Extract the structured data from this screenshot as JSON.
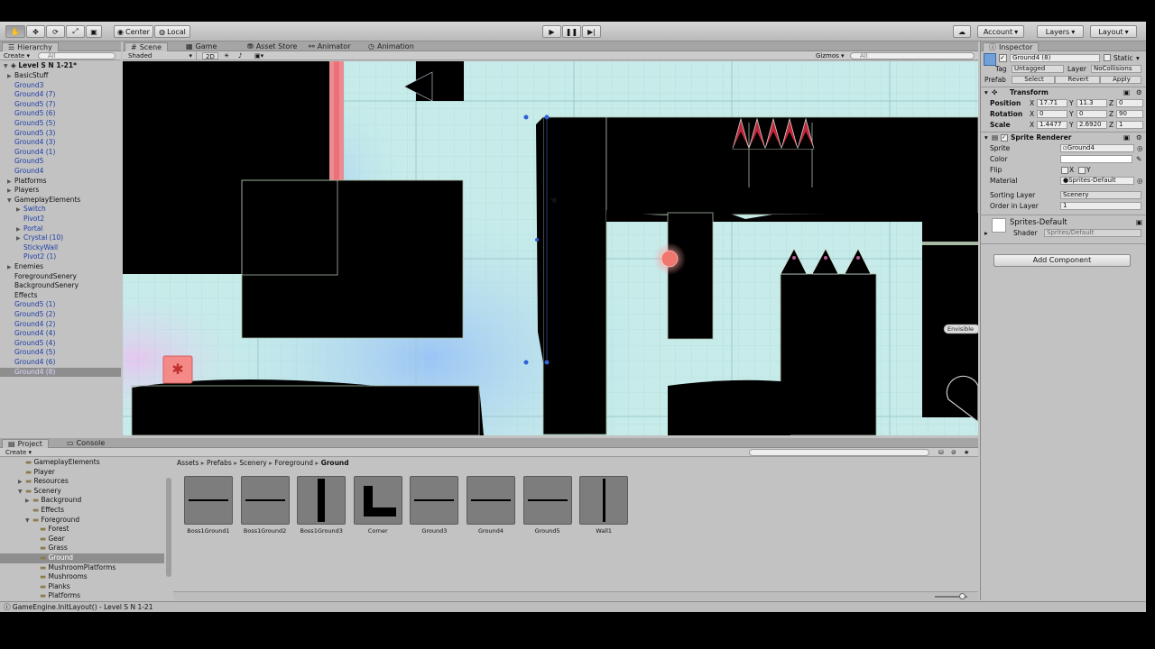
{
  "toolbar": {
    "pivot_label": "Center",
    "space_label": "Local",
    "account_label": "Account",
    "layers_label": "Layers",
    "layout_label": "Layout"
  },
  "hierarchy": {
    "tab": "Hierarchy",
    "create": "Create",
    "search_placeholder": "All",
    "scene_name": "Level S N 1-21*",
    "items": [
      {
        "label": "BasicStuff",
        "indent": 1,
        "arrow": "right",
        "prefab": false,
        "selected": false
      },
      {
        "label": "Ground3",
        "indent": 1,
        "arrow": "",
        "prefab": true,
        "selected": false
      },
      {
        "label": "Ground4 (7)",
        "indent": 1,
        "arrow": "",
        "prefab": true,
        "selected": false
      },
      {
        "label": "Ground5 (7)",
        "indent": 1,
        "arrow": "",
        "prefab": true,
        "selected": false
      },
      {
        "label": "Ground5 (6)",
        "indent": 1,
        "arrow": "",
        "prefab": true,
        "selected": false
      },
      {
        "label": "Ground5 (5)",
        "indent": 1,
        "arrow": "",
        "prefab": true,
        "selected": false
      },
      {
        "label": "Ground5 (3)",
        "indent": 1,
        "arrow": "",
        "prefab": true,
        "selected": false
      },
      {
        "label": "Ground4 (3)",
        "indent": 1,
        "arrow": "",
        "prefab": true,
        "selected": false
      },
      {
        "label": "Ground4 (1)",
        "indent": 1,
        "arrow": "",
        "prefab": true,
        "selected": false
      },
      {
        "label": "Ground5",
        "indent": 1,
        "arrow": "",
        "prefab": true,
        "selected": false
      },
      {
        "label": "Ground4",
        "indent": 1,
        "arrow": "",
        "prefab": true,
        "selected": false
      },
      {
        "label": "Platforms",
        "indent": 1,
        "arrow": "right",
        "prefab": false,
        "selected": false
      },
      {
        "label": "Players",
        "indent": 1,
        "arrow": "right",
        "prefab": false,
        "selected": false
      },
      {
        "label": "GameplayElements",
        "indent": 1,
        "arrow": "down",
        "prefab": false,
        "selected": false
      },
      {
        "label": "Switch",
        "indent": 2,
        "arrow": "right",
        "prefab": true,
        "selected": false
      },
      {
        "label": "Pivot2",
        "indent": 2,
        "arrow": "",
        "prefab": true,
        "selected": false
      },
      {
        "label": "Portal",
        "indent": 2,
        "arrow": "right",
        "prefab": true,
        "selected": false
      },
      {
        "label": "Crystal (10)",
        "indent": 2,
        "arrow": "right",
        "prefab": true,
        "selected": false
      },
      {
        "label": "StickyWall",
        "indent": 2,
        "arrow": "",
        "prefab": true,
        "selected": false
      },
      {
        "label": "Pivot2 (1)",
        "indent": 2,
        "arrow": "",
        "prefab": true,
        "selected": false
      },
      {
        "label": "Enemies",
        "indent": 1,
        "arrow": "right",
        "prefab": false,
        "selected": false
      },
      {
        "label": "ForegroundSenery",
        "indent": 1,
        "arrow": "",
        "prefab": false,
        "selected": false
      },
      {
        "label": "BackgroundSenery",
        "indent": 1,
        "arrow": "",
        "prefab": false,
        "selected": false
      },
      {
        "label": "Effects",
        "indent": 1,
        "arrow": "",
        "prefab": false,
        "selected": false
      },
      {
        "label": "Ground5 (1)",
        "indent": 1,
        "arrow": "",
        "prefab": true,
        "selected": false
      },
      {
        "label": "Ground5 (2)",
        "indent": 1,
        "arrow": "",
        "prefab": true,
        "selected": false
      },
      {
        "label": "Ground4 (2)",
        "indent": 1,
        "arrow": "",
        "prefab": true,
        "selected": false
      },
      {
        "label": "Ground4 (4)",
        "indent": 1,
        "arrow": "",
        "prefab": true,
        "selected": false
      },
      {
        "label": "Ground5 (4)",
        "indent": 1,
        "arrow": "",
        "prefab": true,
        "selected": false
      },
      {
        "label": "Ground4 (5)",
        "indent": 1,
        "arrow": "",
        "prefab": true,
        "selected": false
      },
      {
        "label": "Ground4 (6)",
        "indent": 1,
        "arrow": "",
        "prefab": true,
        "selected": false
      },
      {
        "label": "Ground4 (8)",
        "indent": 1,
        "arrow": "",
        "prefab": true,
        "selected": true
      }
    ]
  },
  "scene_tabs": {
    "scene": "Scene",
    "game": "Game",
    "asset_store": "Asset Store",
    "animator": "Animator",
    "animation": "Animation",
    "shaded": "Shaded",
    "mode_2d": "2D",
    "gizmos": "Gizmos",
    "search_placeholder": "All",
    "invisible_label": "Envisible"
  },
  "inspector": {
    "tab": "Inspector",
    "object_name": "Ground4 (8)",
    "static_label": "Static",
    "tag_label": "Tag",
    "tag_value": "Untagged",
    "layer_label": "Layer",
    "layer_value": "NoCollisions",
    "prefab_label": "Prefab",
    "prefab_select": "Select",
    "prefab_revert": "Revert",
    "prefab_apply": "Apply",
    "transform": {
      "title": "Transform",
      "position_label": "Position",
      "rotation_label": "Rotation",
      "scale_label": "Scale",
      "position": {
        "x": "17.71",
        "y": "11.3",
        "z": "0"
      },
      "rotation": {
        "x": "0",
        "y": "0",
        "z": "90"
      },
      "scale": {
        "x": "1.4477",
        "y": "2.6920",
        "z": "1"
      }
    },
    "sprite_renderer": {
      "title": "Sprite Renderer",
      "sprite_label": "Sprite",
      "sprite_value": "Ground4",
      "color_label": "Color",
      "flip_label": "Flip",
      "flip_x": "X",
      "flip_y": "Y",
      "material_label": "Material",
      "material_value": "Sprites-Default",
      "sorting_layer_label": "Sorting Layer",
      "sorting_layer_value": "Scenery",
      "order_label": "Order in Layer",
      "order_value": "1"
    },
    "material": {
      "name": "Sprites-Default",
      "shader_label": "Shader",
      "shader_value": "Sprites/Default"
    },
    "add_component": "Add Component"
  },
  "project": {
    "tab": "Project",
    "console_tab": "Console",
    "create": "Create",
    "folders": [
      {
        "label": "GameplayElements",
        "indent": 2,
        "arrow": ""
      },
      {
        "label": "Player",
        "indent": 2,
        "arrow": ""
      },
      {
        "label": "Resources",
        "indent": 2,
        "arrow": "right"
      },
      {
        "label": "Scenery",
        "indent": 2,
        "arrow": "down"
      },
      {
        "label": "Background",
        "indent": 3,
        "arrow": "right"
      },
      {
        "label": "Effects",
        "indent": 3,
        "arrow": ""
      },
      {
        "label": "Foreground",
        "indent": 3,
        "arrow": "down"
      },
      {
        "label": "Forest",
        "indent": 4,
        "arrow": ""
      },
      {
        "label": "Gear",
        "indent": 4,
        "arrow": ""
      },
      {
        "label": "Grass",
        "indent": 4,
        "arrow": ""
      },
      {
        "label": "Ground",
        "indent": 4,
        "arrow": "",
        "selected": true
      },
      {
        "label": "MushroomPlatforms",
        "indent": 4,
        "arrow": ""
      },
      {
        "label": "Mushrooms",
        "indent": 4,
        "arrow": ""
      },
      {
        "label": "Planks",
        "indent": 4,
        "arrow": ""
      },
      {
        "label": "Platforms",
        "indent": 4,
        "arrow": ""
      }
    ],
    "breadcrumb": [
      "Assets",
      "Prefabs",
      "Scenery",
      "Foreground",
      "Ground"
    ],
    "assets": [
      {
        "label": "Boss1Ground1",
        "shape": "hline"
      },
      {
        "label": "Boss1Ground2",
        "shape": "hline"
      },
      {
        "label": "Boss1Ground3",
        "shape": "vbar"
      },
      {
        "label": "Corner",
        "shape": "corner"
      },
      {
        "label": "Ground3",
        "shape": "hline"
      },
      {
        "label": "Ground4",
        "shape": "hline"
      },
      {
        "label": "Ground5",
        "shape": "hline"
      },
      {
        "label": "Wall1",
        "shape": "vline"
      }
    ]
  },
  "status": {
    "text": "GameEngine.InitLayout() - Level S N 1-21"
  },
  "colors": {
    "panel": "#c2c2c2",
    "scene_bg": "#c8ecec",
    "selection": "#8e8e8e",
    "prefab_text": "#1e3ea8",
    "spike": "#c0263a"
  }
}
